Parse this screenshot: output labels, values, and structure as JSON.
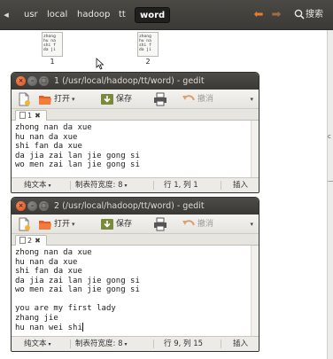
{
  "pathbar": {
    "crumbs": [
      "usr",
      "local",
      "hadoop",
      "tt",
      "word"
    ],
    "search_label": "搜索"
  },
  "desktop": {
    "files": [
      {
        "name": "1",
        "preview": [
          "zhong",
          "hu na",
          "shi f",
          "da ji"
        ]
      },
      {
        "name": "2",
        "preview": [
          "zhong",
          "hu na",
          "shi f",
          "da ji"
        ]
      }
    ]
  },
  "toolbar": {
    "open_label": "打开",
    "save_label": "保存",
    "undo_label": "撤消"
  },
  "windows": [
    {
      "title": "1 (/usr/local/hadoop/tt/word) - gedit",
      "tab_label": "1",
      "lines": [
        "zhong nan da xue",
        "hu nan da xue",
        "shi fan da xue",
        "da jia zai lan jie gong si",
        "wo men zai lan jie gong si"
      ],
      "status": {
        "syntax": "纯文本",
        "tab_width": "制表符宽度: 8",
        "position": "行 1, 列 1",
        "mode": "插入"
      }
    },
    {
      "title": "2 (/usr/local/hadoop/tt/word) - gedit",
      "tab_label": "2",
      "lines": [
        "zhong nan da xue",
        "hu nan da xue",
        "shi fan da xue",
        "da jia zai lan jie gong si",
        "wo men zai lan jie gong si",
        "",
        "you are my first lady",
        "zhang jie",
        "hu nan wei shi"
      ],
      "status": {
        "syntax": "纯文本",
        "tab_width": "制表符宽度: 8",
        "position": "行 9, 列 15",
        "mode": "插入"
      }
    }
  ],
  "colors": {
    "accent_orange": "#f07a2a",
    "titlebar_dark": "#3a3935",
    "close_button": "#d94c1b"
  }
}
